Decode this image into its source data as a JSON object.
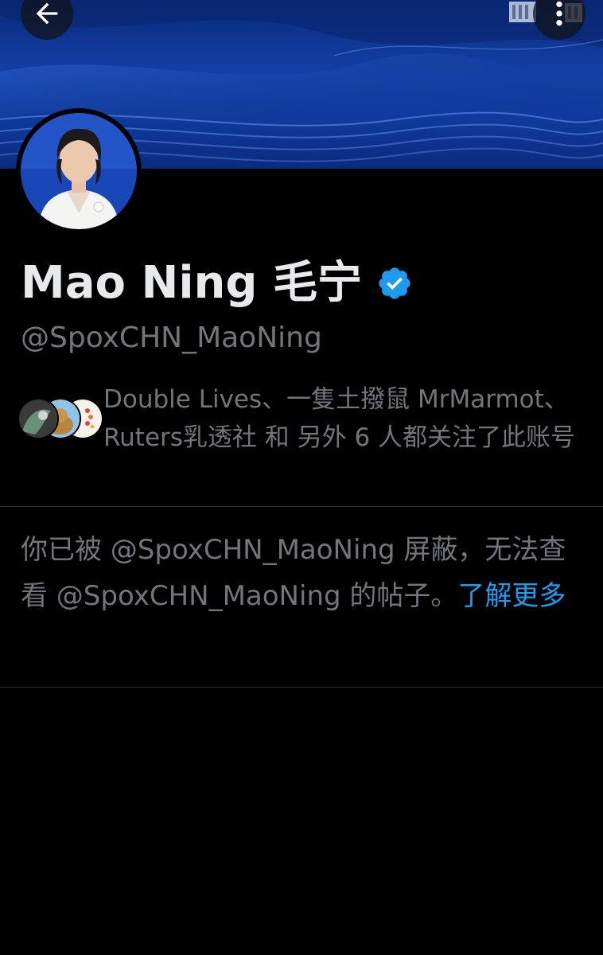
{
  "header": {
    "back_icon": "arrow-left-icon",
    "more_icon": "more-vertical-icon",
    "banner_colors": [
      "#0a2a7a",
      "#1340a8",
      "#3a7be0"
    ]
  },
  "profile": {
    "display_name": "Mao Ning 毛宁",
    "handle": "@SpoxCHN_MaoNing",
    "verified_color": "#1d9bf0",
    "verified_icon": "verified-badge-icon"
  },
  "followers": {
    "text": "Double Lives、一隻土撥鼠 MrMarmot、Ruters乳透社 和 另外 6 人都关注了此账号"
  },
  "blocked_notice": {
    "text": "你已被 @SpoxCHN_MaoNing 屏蔽，无法查看 @SpoxCHN_MaoNing 的帖子。",
    "link": "了解更多",
    "link_color": "#1d9bf0"
  }
}
